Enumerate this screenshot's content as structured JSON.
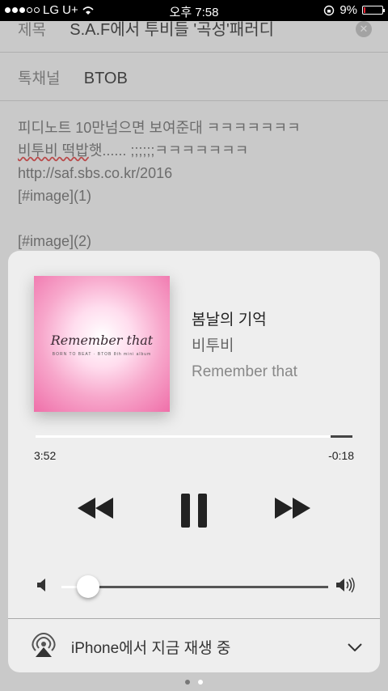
{
  "status_bar": {
    "carrier": "LG U+",
    "time": "오후 7:58",
    "battery": "9%"
  },
  "background_note": {
    "subject_label": "제목",
    "subject_value": "S.A.F에서 투비들 '곡성'패러디",
    "channel_label": "톡채널",
    "channel_value": "BTOB",
    "body_lines": [
      "피디노트 10만넘으면 보여준대 ㅋㅋㅋㅋㅋㅋㅋ",
      "비투비 떡밥",
      "햇...... ;;;;;;ㅋㅋㅋㅋㅋㅋㅋ",
      "http://saf.sbs.co.kr/2016",
      "[#image](1)",
      "[#image](2)"
    ]
  },
  "now_playing": {
    "song": "봄날의 기억",
    "artist": "비투비",
    "album": "Remember that",
    "elapsed": "3:52",
    "remaining": "-0:18",
    "progress": 0.93,
    "volume": 0.1,
    "album_art_title": "Remember that",
    "album_art_subtitle": "BORN TO BEAT · BTOB 8th mini album"
  },
  "airplay": {
    "label": "iPhone에서 지금 재생 중"
  },
  "colors": {
    "accent": "#ffffff",
    "art_pink": "#ef6fa9",
    "battery_low": "#ee2233"
  },
  "icons": [
    "airplay-icon",
    "rewind-icon",
    "pause-icon",
    "fast-forward-icon",
    "volume-low-icon",
    "volume-high-icon",
    "chevron-down-icon",
    "wifi-icon",
    "battery-icon"
  ]
}
